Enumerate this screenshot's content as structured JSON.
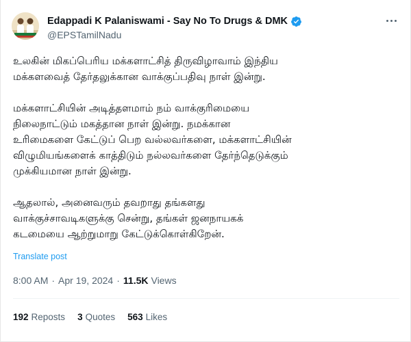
{
  "author": {
    "display_name": "Edappadi K Palaniswami - Say No To Drugs & DMK",
    "handle": "@EPSTamilNadu",
    "verified_icon": "verified-badge-icon",
    "accent": "#1d9bf0"
  },
  "tweet": {
    "paragraphs": [
      [
        "உலகின் மிகப்பெரிய மக்களாட்சித் திருவிழாவாம் இந்திய",
        "மக்களவைத் தேர்தலுக்கான வாக்குப்பதிவு நாள் இன்று."
      ],
      [
        "மக்களாட்சியின் அடித்தளமாம் நம் வாக்குரிமையை",
        "நிலைநாட்டும் மகத்தான நாள் இன்று. நமக்கான",
        "உரிமைகளை கேட்டுப் பெற வல்லவர்களை, மக்களாட்சியின்",
        "விழுமியங்களைக் காத்திடும் நல்லவர்களை தேர்ந்தெடுக்கும்",
        "முக்கியமான நாள் இன்று."
      ],
      [
        "ஆதலால், அனைவரும் தவறாது தங்களது",
        "வாக்குச்சாவடிகளுக்கு சென்று, தங்கள் ஜனநாயகக்",
        "கடமையை ஆற்றுமாறு கேட்டுக்கொள்கிறேன்."
      ]
    ],
    "translate_label": "Translate post",
    "time": "8:00 AM",
    "date": "Apr 19, 2024",
    "separator": "·",
    "views_count": "11.5K",
    "views_label": "Views"
  },
  "stats": {
    "reposts_count": "192",
    "reposts_label": "Reposts",
    "quotes_count": "3",
    "quotes_label": "Quotes",
    "likes_count": "563",
    "likes_label": "Likes"
  }
}
